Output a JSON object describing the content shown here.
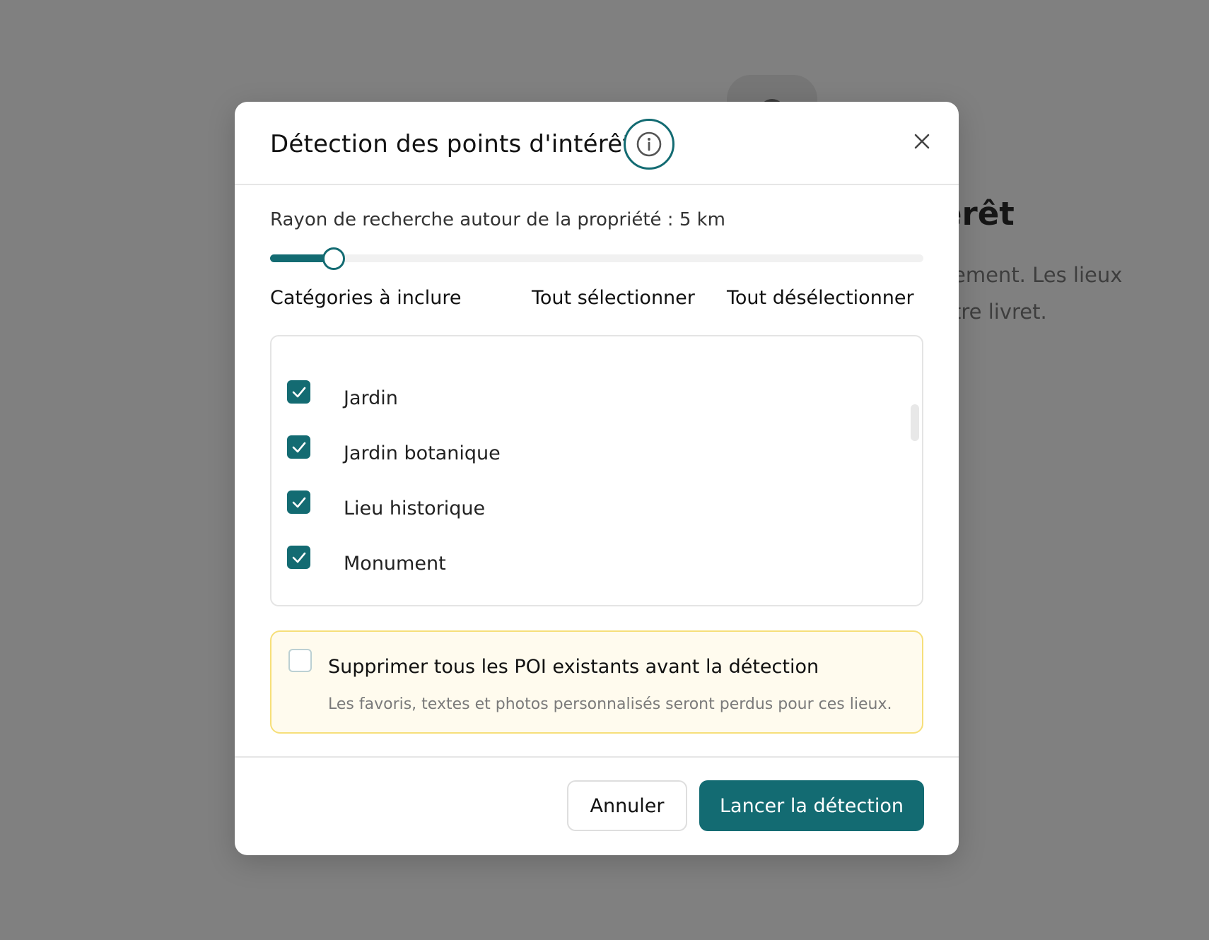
{
  "background": {
    "title_fragment": "érêt",
    "text_line1": "ement. Les lieux",
    "text_line2": "tre livret."
  },
  "modal": {
    "title": "Détection des points d'intérêt",
    "radius": {
      "label": "Rayon de recherche autour de la propriété : 5 km",
      "value_km": 5,
      "min_km": 0,
      "max_km": 50,
      "fraction": 0.097
    },
    "categories": {
      "label": "Catégories à inclure",
      "select_all": "Tout sélectionner",
      "deselect_all": "Tout désélectionner",
      "items": [
        {
          "label": "Jardin",
          "checked": true
        },
        {
          "label": "Jardin botanique",
          "checked": true
        },
        {
          "label": "Lieu historique",
          "checked": true
        },
        {
          "label": "Monument",
          "checked": true
        }
      ]
    },
    "warning": {
      "label": "Supprimer tous les POI existants avant la détection",
      "description": "Les favoris, textes et photos personnalisés seront perdus pour ces lieux.",
      "checked": false
    },
    "footer": {
      "cancel_label": "Annuler",
      "submit_label": "Lancer la détection"
    }
  },
  "colors": {
    "accent": "#136b72",
    "warning_bg": "#fffbee",
    "warning_border": "#f6df7a",
    "overlay": "#808080"
  }
}
